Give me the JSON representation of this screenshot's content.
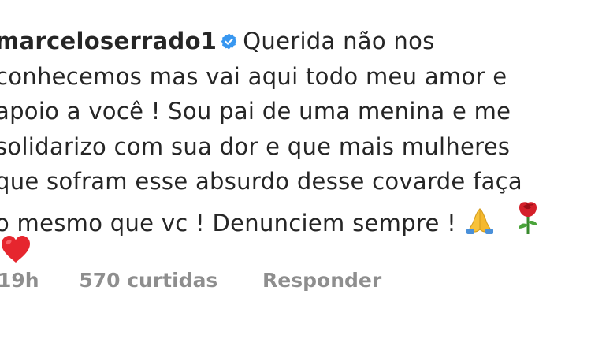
{
  "comment": {
    "username": "marceloserrado1",
    "verified_icon": "verified-badge-icon",
    "lines": [
      "Querida não nos",
      "conhecemos mas vai aqui todo meu amor e",
      "apoio a você ! Sou pai de uma menina e me",
      "solidarizo com sua dor e que mais mulheres",
      "que sofram esse absurdo desse covarde faça",
      "o mesmo que vc ! Denunciem sempre !"
    ],
    "emojis": [
      "folded-hands-icon",
      "rose-icon",
      "red-heart-icon"
    ]
  },
  "meta": {
    "time": "19h",
    "likes": "570 curtidas",
    "reply": "Responder"
  },
  "colors": {
    "text": "#262626",
    "muted": "#8e8e8e",
    "verified": "#3897f0"
  }
}
